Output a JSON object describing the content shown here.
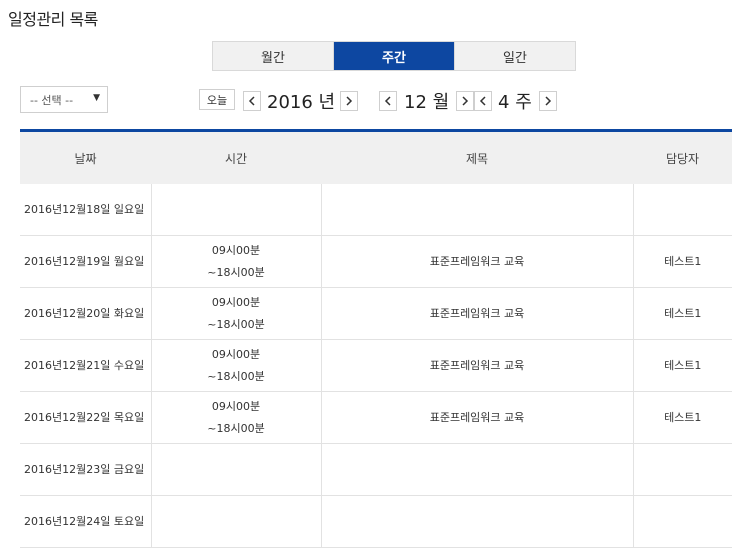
{
  "page": {
    "title": "일정관리 목록"
  },
  "view_tabs": [
    {
      "label": "월간",
      "active": false
    },
    {
      "label": "주간",
      "active": true
    },
    {
      "label": "일간",
      "active": false
    }
  ],
  "filter": {
    "selected": "-- 선택 --"
  },
  "nav": {
    "today_label": "오늘",
    "year": "2016",
    "year_unit": "년",
    "month": "12",
    "month_unit": "월",
    "week": "4",
    "week_unit": "주"
  },
  "table": {
    "headers": [
      "날짜",
      "시간",
      "제목",
      "담당자"
    ],
    "rows": [
      {
        "date": "2016년12월18일 일요일",
        "time_start": "",
        "time_end": "",
        "title": "",
        "owner": ""
      },
      {
        "date": "2016년12월19일 월요일",
        "time_start": "09시00분",
        "time_end": "~18시00분",
        "title": "표준프레임워크 교육",
        "owner": "테스트1"
      },
      {
        "date": "2016년12월20일 화요일",
        "time_start": "09시00분",
        "time_end": "~18시00분",
        "title": "표준프레임워크 교육",
        "owner": "테스트1"
      },
      {
        "date": "2016년12월21일 수요일",
        "time_start": "09시00분",
        "time_end": "~18시00분",
        "title": "표준프레임워크 교육",
        "owner": "테스트1"
      },
      {
        "date": "2016년12월22일 목요일",
        "time_start": "09시00분",
        "time_end": "~18시00분",
        "title": "표준프레임워크 교육",
        "owner": "테스트1"
      },
      {
        "date": "2016년12월23일 금요일",
        "time_start": "",
        "time_end": "",
        "title": "",
        "owner": ""
      },
      {
        "date": "2016년12월24일 토요일",
        "time_start": "",
        "time_end": "",
        "title": "",
        "owner": ""
      }
    ]
  },
  "colors": {
    "accent": "#0d47a1",
    "header_bg": "#f0f0f0",
    "border": "#e2e2e2"
  }
}
